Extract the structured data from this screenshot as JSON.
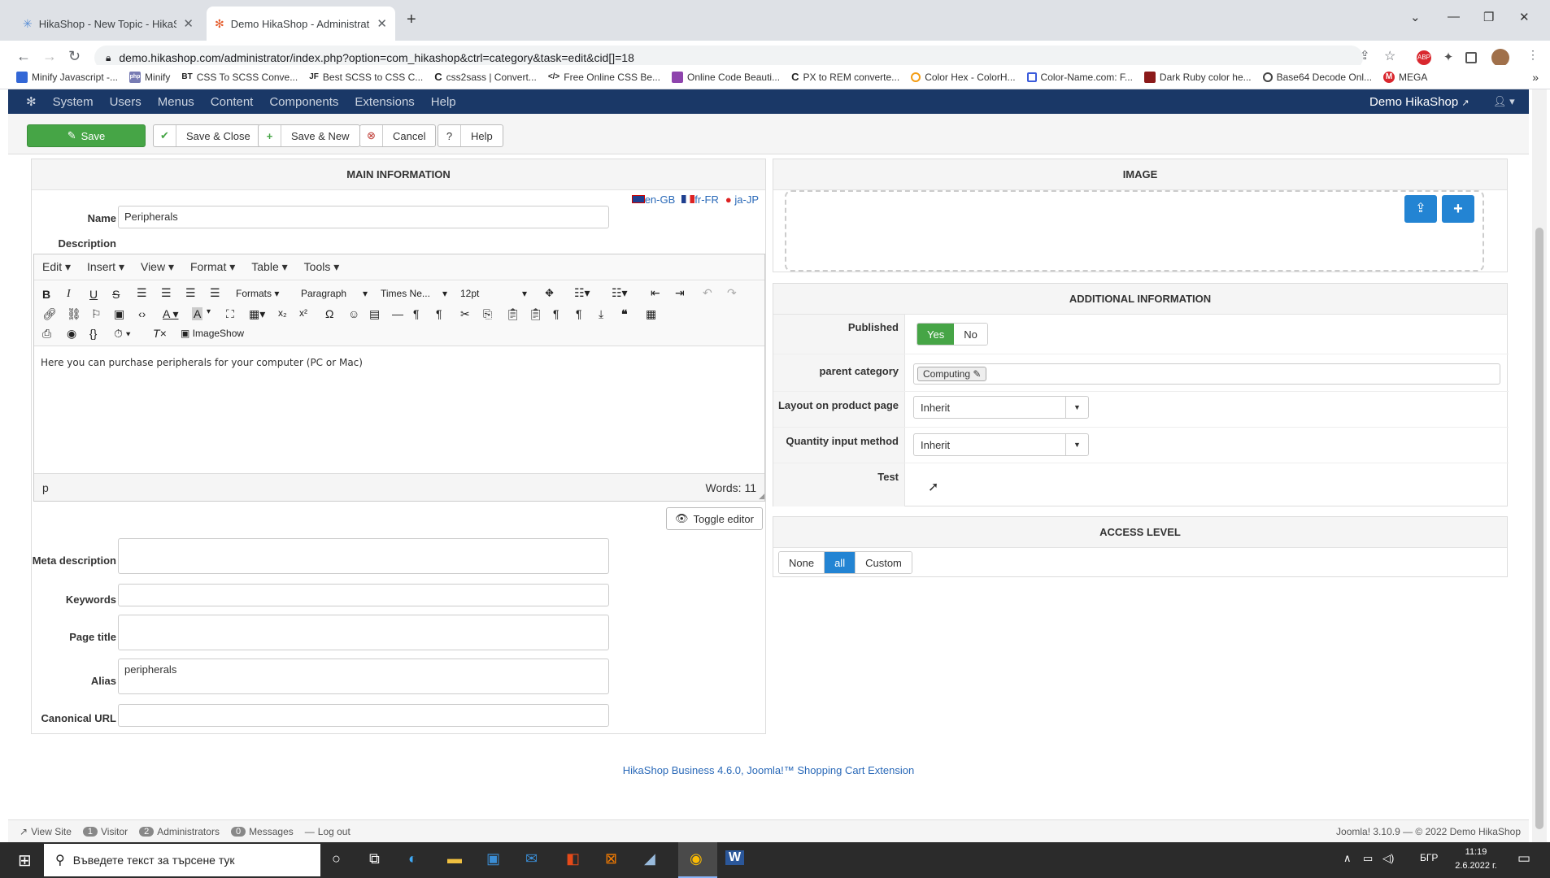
{
  "browser": {
    "tabs": [
      {
        "title": "HikaShop - New Topic - HikaSho",
        "active": false
      },
      {
        "title": "Demo HikaShop - Administration",
        "active": true
      }
    ],
    "new_tab": "+",
    "url": "demo.hikashop.com/administrator/index.php?option=com_hikashop&ctrl=category&task=edit&cid[]=18",
    "bookmarks": [
      {
        "label": "Minify Javascript -...",
        "color": "#3367d6"
      },
      {
        "label": "Minify",
        "color": "#777bb3"
      },
      {
        "label": "CSS To SCSS Conve...",
        "color": "#222"
      },
      {
        "label": "Best SCSS to CSS C...",
        "color": "#222"
      },
      {
        "label": "css2sass | Convert...",
        "color": "#222"
      },
      {
        "label": "Free Online CSS Be...",
        "color": "#222"
      },
      {
        "label": "Online Code Beauti...",
        "color": "#8e44ad"
      },
      {
        "label": "PX to REM converte...",
        "color": "#222"
      },
      {
        "label": "Color Hex - ColorH...",
        "color": "#f39c12"
      },
      {
        "label": "Color-Name.com: F...",
        "color": "#3b5bdb"
      },
      {
        "label": "Dark Ruby color he...",
        "color": "#8b1a1a"
      },
      {
        "label": "Base64 Decode Onl...",
        "color": "#444"
      },
      {
        "label": "MEGA",
        "color": "#d9272e"
      }
    ],
    "bookmark_icons": [
      "BT",
      "JF",
      "C",
      "</>",
      "C"
    ]
  },
  "joomla": {
    "menu": [
      "System",
      "Users",
      "Menus",
      "Content",
      "Components",
      "Extensions",
      "Help"
    ],
    "site_name": "Demo HikaShop",
    "toolbar": {
      "save": "Save",
      "save_close": "Save & Close",
      "save_new": "Save & New",
      "cancel": "Cancel",
      "help": "Help"
    }
  },
  "main_info": {
    "heading": "MAIN INFORMATION",
    "languages": [
      "en-GB",
      "fr-FR",
      "ja-JP"
    ],
    "name_label": "Name",
    "name_value": "Peripherals",
    "description_label": "Description",
    "editor": {
      "menus": [
        "Edit",
        "Insert",
        "View",
        "Format",
        "Table",
        "Tools"
      ],
      "formats": "Formats",
      "paragraph": "Paragraph",
      "font": "Times Ne...",
      "size": "12pt",
      "imageshow": "ImageShow",
      "content": "Here you can purchase peripherals for your computer (PC or Mac)",
      "path": "p",
      "words": "Words: 11"
    },
    "toggle_editor": "Toggle editor",
    "meta_description_label": "Meta description",
    "keywords_label": "Keywords",
    "page_title_label": "Page title",
    "alias_label": "Alias",
    "alias_value": "peripherals",
    "canonical_label": "Canonical URL"
  },
  "image_panel": {
    "heading": "IMAGE"
  },
  "additional": {
    "heading": "ADDITIONAL INFORMATION",
    "published_label": "Published",
    "yes": "Yes",
    "no": "No",
    "parent_label": "parent category",
    "parent_value": "Computing",
    "layout_label": "Layout on product page",
    "layout_value": "Inherit",
    "qty_label": "Quantity input method",
    "qty_value": "Inherit",
    "test_label": "Test"
  },
  "access": {
    "heading": "ACCESS LEVEL",
    "options": [
      "None",
      "all",
      "Custom"
    ],
    "selected": "all"
  },
  "footer_text": "HikaShop Business 4.6.0, Joomla!™ Shopping Cart Extension",
  "statusbar": {
    "view_site": "View Site",
    "visitor_count": "1",
    "visitor": "Visitor",
    "admin_count": "2",
    "admins": "Administrators",
    "msg_count": "0",
    "messages": "Messages",
    "logout": "Log out",
    "version": "Joomla! 3.10.9 — © 2022 Demo HikaShop"
  },
  "taskbar": {
    "search_placeholder": "Въведете текст за търсене тук",
    "lang": "БГР",
    "time": "11:19",
    "date": "2.6.2022 г."
  },
  "colors": {
    "save_green": "#46a546",
    "joomla_nav": "#1a3867",
    "primary_blue": "#2384d3",
    "link_blue": "#2a69b8"
  }
}
